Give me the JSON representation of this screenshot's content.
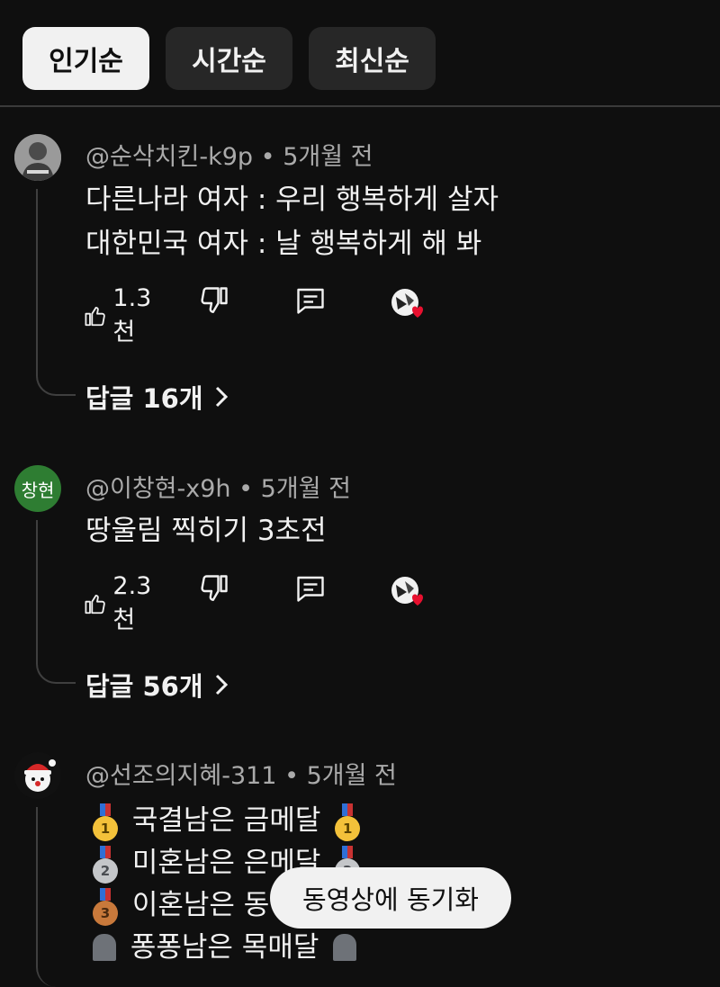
{
  "filters": [
    {
      "label": "인기순",
      "active": true
    },
    {
      "label": "시간순",
      "active": false
    },
    {
      "label": "최신순",
      "active": false
    }
  ],
  "comments": [
    {
      "author": "@순삭치킨-k9p",
      "time": "5개월 전",
      "avatar_text": "",
      "avatar_icon": "photo-avatar",
      "lines": [
        "다른나라 여자 : 우리 행복하게 살자",
        "대한민국 여자 : 날 행복하게 해 봐"
      ],
      "likes": "1.3천",
      "replies": "답글 16개"
    },
    {
      "author": "@이창현-x9h",
      "time": "5개월 전",
      "avatar_text": "창현",
      "avatar_color": "#2e7d32",
      "lines": [
        "땅울림 찍히기 3초전"
      ],
      "likes": "2.3천",
      "replies": "답글 56개"
    },
    {
      "author": "@선조의지혜-311",
      "time": "5개월 전",
      "avatar_icon": "santa-avatar",
      "lines": [
        {
          "icon": "gold-medal-icon",
          "text": "국결남은 금메달"
        },
        {
          "icon": "silver-medal-icon",
          "text": "미혼남은 은메달"
        },
        {
          "icon": "bronze-medal-icon",
          "text": "이혼남은 동"
        },
        {
          "icon": "tombstone-icon",
          "text": "퐁퐁남은 목매달"
        }
      ]
    }
  ],
  "separator": "•",
  "toast": "동영상에 동기화",
  "colors": {
    "background": "#0f0f0f",
    "chip_bg": "#272727",
    "chip_active_bg": "#f1f1f1",
    "meta_text": "#aaaaaa",
    "heart": "#e8102f"
  }
}
